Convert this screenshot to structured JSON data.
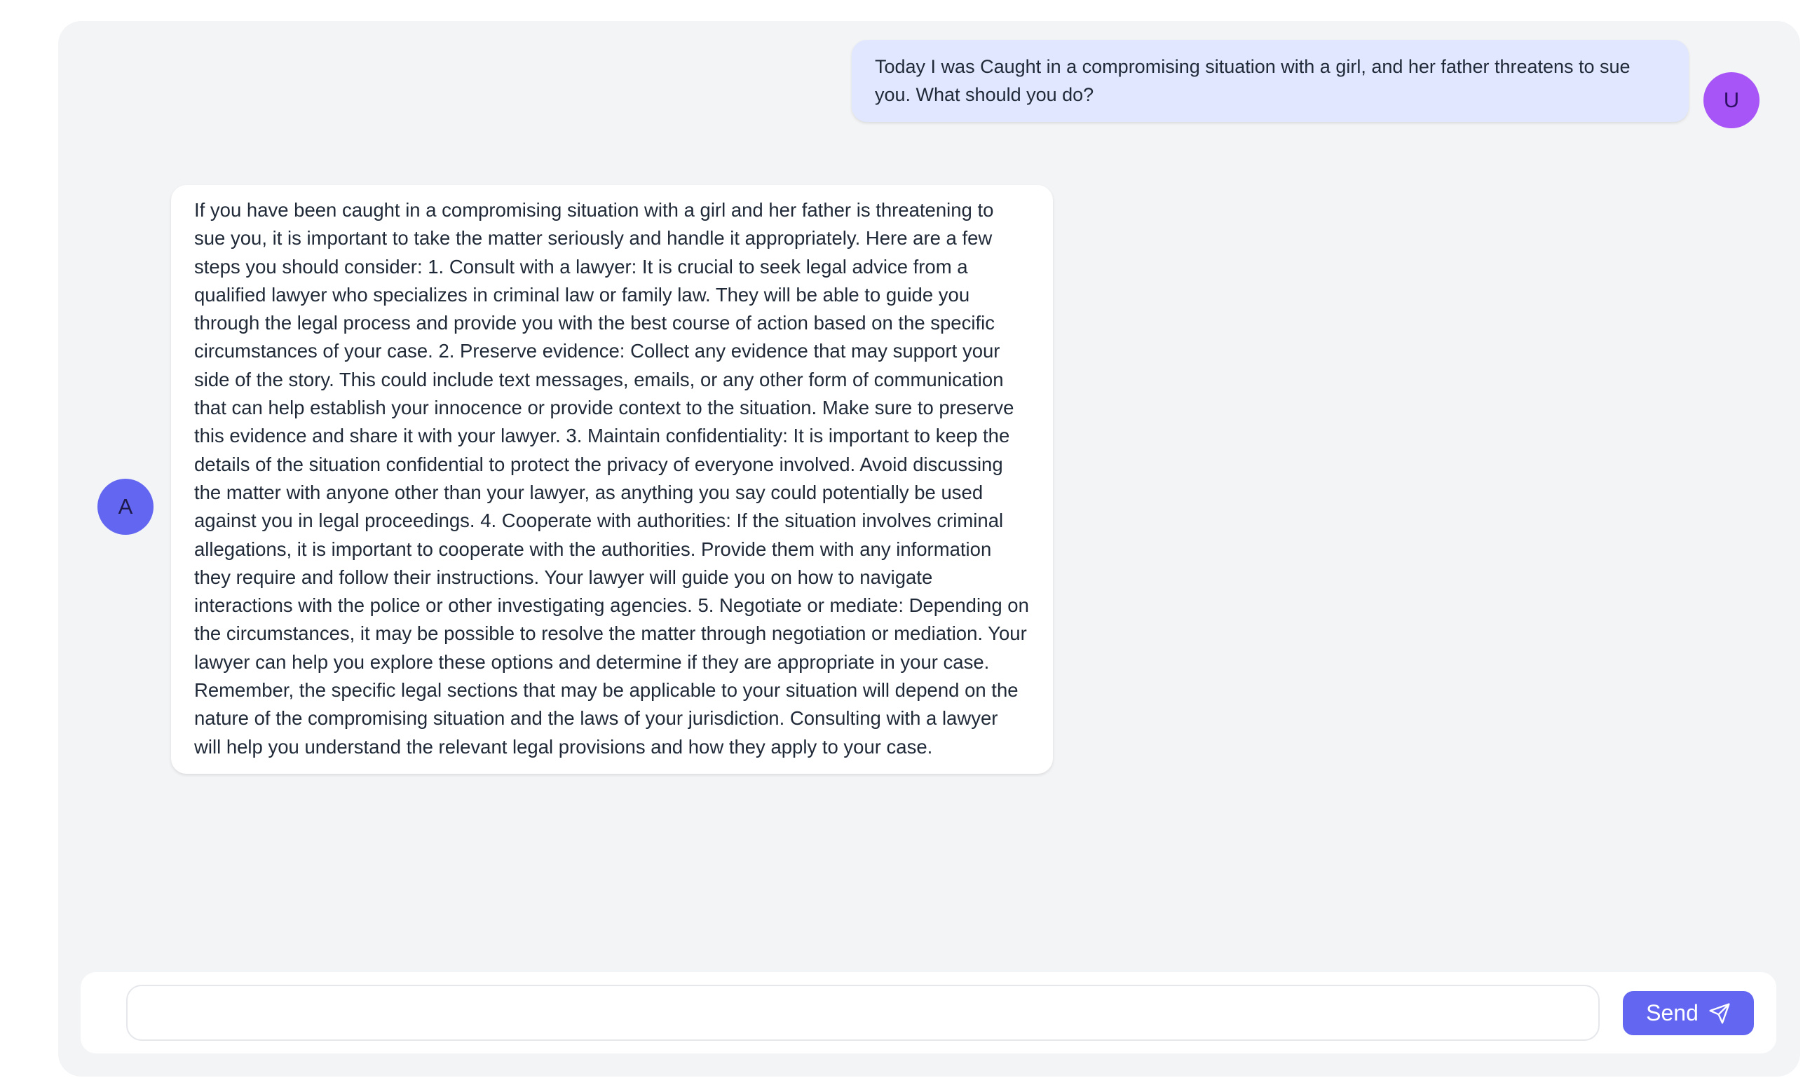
{
  "conversation": {
    "user_message": {
      "avatar_initial": "U",
      "text": "Today I was Caught in a compromising situation with a girl, and her father threatens to sue you. What should you do?"
    },
    "assistant_message": {
      "avatar_initial": "A",
      "text": "If you have been caught in a compromising situation with a girl and her father is threatening to sue you, it is important to take the matter seriously and handle it appropriately. Here are a few steps you should consider: 1. Consult with a lawyer: It is crucial to seek legal advice from a qualified lawyer who specializes in criminal law or family law. They will be able to guide you through the legal process and provide you with the best course of action based on the specific circumstances of your case. 2. Preserve evidence: Collect any evidence that may support your side of the story. This could include text messages, emails, or any other form of communication that can help establish your innocence or provide context to the situation. Make sure to preserve this evidence and share it with your lawyer. 3. Maintain confidentiality: It is important to keep the details of the situation confidential to protect the privacy of everyone involved. Avoid discussing the matter with anyone other than your lawyer, as anything you say could potentially be used against you in legal proceedings. 4. Cooperate with authorities: If the situation involves criminal allegations, it is important to cooperate with the authorities. Provide them with any information they require and follow their instructions. Your lawyer will guide you on how to navigate interactions with the police or other investigating agencies. 5. Negotiate or mediate: Depending on the circumstances, it may be possible to resolve the matter through negotiation or mediation. Your lawyer can help you explore these options and determine if they are appropriate in your case. Remember, the specific legal sections that may be applicable to your situation will depend on the nature of the compromising situation and the laws of your jurisdiction. Consulting with a lawyer will help you understand the relevant legal provisions and how they apply to your case."
    }
  },
  "composer": {
    "input_value": "",
    "input_placeholder": "",
    "send_label": "Send",
    "send_icon": "paper-plane-icon"
  },
  "colors": {
    "panel_background": "#f3f4f6",
    "user_bubble": "#e0e7ff",
    "assistant_bubble": "#ffffff",
    "user_avatar": "#a855f7",
    "assistant_avatar": "#6366f1",
    "send_button": "#6366f1"
  }
}
